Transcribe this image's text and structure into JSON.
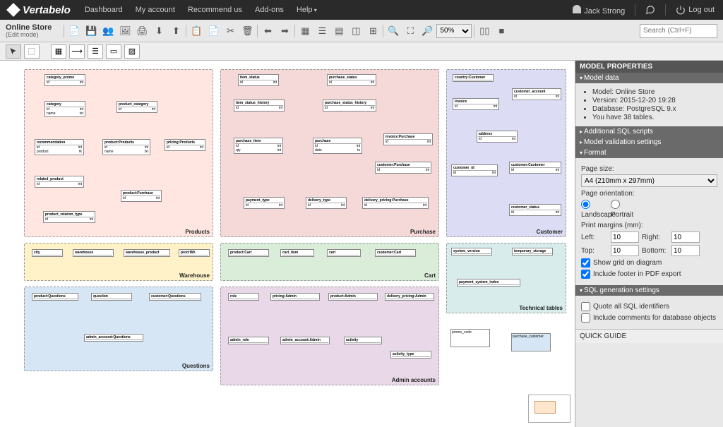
{
  "brand": "Vertabelo",
  "nav": {
    "dashboard": "Dashboard",
    "my_account": "My account",
    "recommend": "Recommend us",
    "addons": "Add-ons",
    "help": "Help"
  },
  "user": {
    "name": "Jack Strong",
    "logout": "Log out"
  },
  "model": {
    "name": "Online Store",
    "mode": "(Edit mode)"
  },
  "toolbar": {
    "zoom": "50%",
    "search_placeholder": "Search (Ctrl+F)"
  },
  "groups": {
    "products": "Products",
    "purchase": "Purchase",
    "customer": "Customer",
    "warehouse": "Warehouse",
    "cart": "Cart",
    "technical": "Technical tables",
    "questions": "Questions",
    "admin": "Admin accounts"
  },
  "sidebar": {
    "title": "MODEL PROPERTIES",
    "model_data": "Model data",
    "props": {
      "model": "Model: Online Store",
      "version": "Version: 2015-12-20 19:28",
      "database": "Database: PostgreSQL 9.x",
      "tables": "You have 38 tables."
    },
    "scripts": "Additional SQL scripts",
    "validation": "Model validation settings",
    "format": "Format",
    "format_body": {
      "page_size_label": "Page size:",
      "page_size": "A4 (210mm x 297mm)",
      "orientation_label": "Page orientation:",
      "landscape": "Landscape",
      "portrait": "Portrait",
      "margins_label": "Print margins (mm):",
      "left": "Left:",
      "left_v": "10",
      "right": "Right:",
      "right_v": "10",
      "top": "Top:",
      "top_v": "10",
      "bottom": "Bottom:",
      "bottom_v": "10",
      "show_grid": "Show grid on diagram",
      "include_footer": "Include footer in PDF export"
    },
    "sql_gen": "SQL generation settings",
    "sql_body": {
      "quote_all": "Quote all SQL identifiers",
      "include_comments": "Include comments for database objects"
    },
    "quick_guide": "QUICK GUIDE"
  }
}
